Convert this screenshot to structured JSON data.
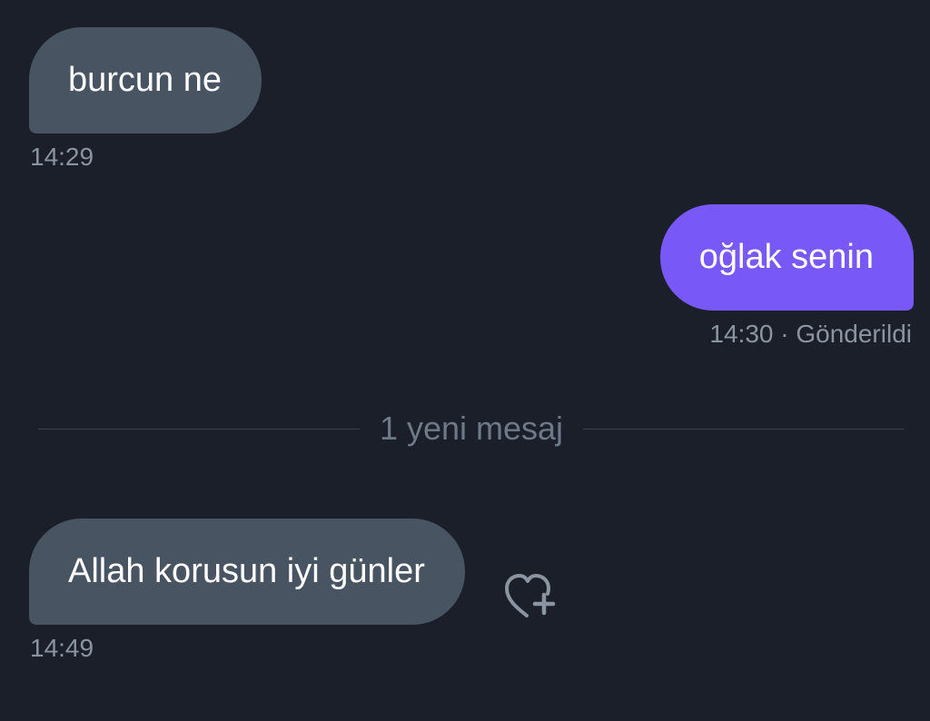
{
  "messages": [
    {
      "direction": "incoming",
      "text": "burcun ne",
      "time": "14:29"
    },
    {
      "direction": "outgoing",
      "text": "oğlak senin",
      "time": "14:30",
      "status": "Gönderildi",
      "separator": " · "
    },
    {
      "direction": "incoming",
      "text": "Allah korusun iyi günler",
      "time": "14:49"
    }
  ],
  "divider": {
    "label": "1 yeni mesaj"
  },
  "reaction": {
    "icon": "heart-plus-icon"
  },
  "colors": {
    "background": "#1a1f29",
    "incoming_bubble": "#485462",
    "outgoing_bubble": "#7858f6",
    "meta_text": "#8b95a1"
  }
}
